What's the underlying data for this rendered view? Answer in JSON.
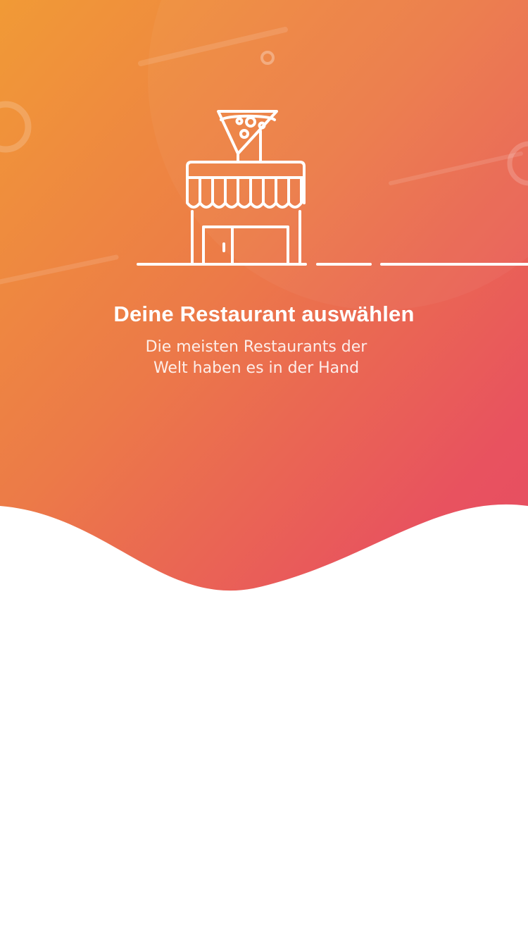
{
  "onboarding": {
    "title": "Deine Restaurant auswählen",
    "subtitle_line1": "Die meisten Restaurants der",
    "subtitle_line2": "Welt haben es in der Hand"
  },
  "illustration": {
    "icon": "restaurant-storefront-with-pizza-icon"
  },
  "colors": {
    "gradient_start": "#f0953a",
    "gradient_mid": "#ec7747",
    "gradient_end": "#e8515f",
    "text": "#ffffff",
    "background": "#ffffff"
  }
}
